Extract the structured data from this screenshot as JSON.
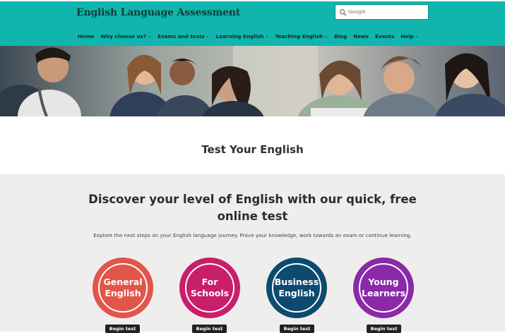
{
  "header": {
    "brand": "English Language Assessment",
    "search_placeholder": "Google",
    "background": "#10b5ad"
  },
  "nav": {
    "items": [
      {
        "label": "Home",
        "dropdown": false
      },
      {
        "label": "Why choose us?",
        "dropdown": true
      },
      {
        "label": "Exams and tests",
        "dropdown": true
      },
      {
        "label": "Learning English",
        "dropdown": true
      },
      {
        "label": "Teaching English",
        "dropdown": true
      },
      {
        "label": "Blog",
        "dropdown": false
      },
      {
        "label": "News",
        "dropdown": false
      },
      {
        "label": "Events",
        "dropdown": false
      },
      {
        "label": "Help",
        "dropdown": true
      }
    ]
  },
  "page": {
    "title": "Test Your English",
    "headline": "Discover your level of English with our quick, free online test",
    "subtext": "Explore the next steps on your English language journey. Prove your knowledge, work towards an exam or continue learning."
  },
  "tests": [
    {
      "label": "General English",
      "line1": "General",
      "line2": "English",
      "color": "#e2554a",
      "button": "Begin test"
    },
    {
      "label": "For Schools",
      "line1": "For",
      "line2": "Schools",
      "color": "#c91e6a",
      "button": "Begin test"
    },
    {
      "label": "Business English",
      "line1": "Business",
      "line2": "English",
      "color": "#0d4a70",
      "button": "Begin test"
    },
    {
      "label": "Young Learners",
      "line1": "Young",
      "line2": "Learners",
      "color": "#8a2aa8",
      "button": "Begin test"
    }
  ]
}
